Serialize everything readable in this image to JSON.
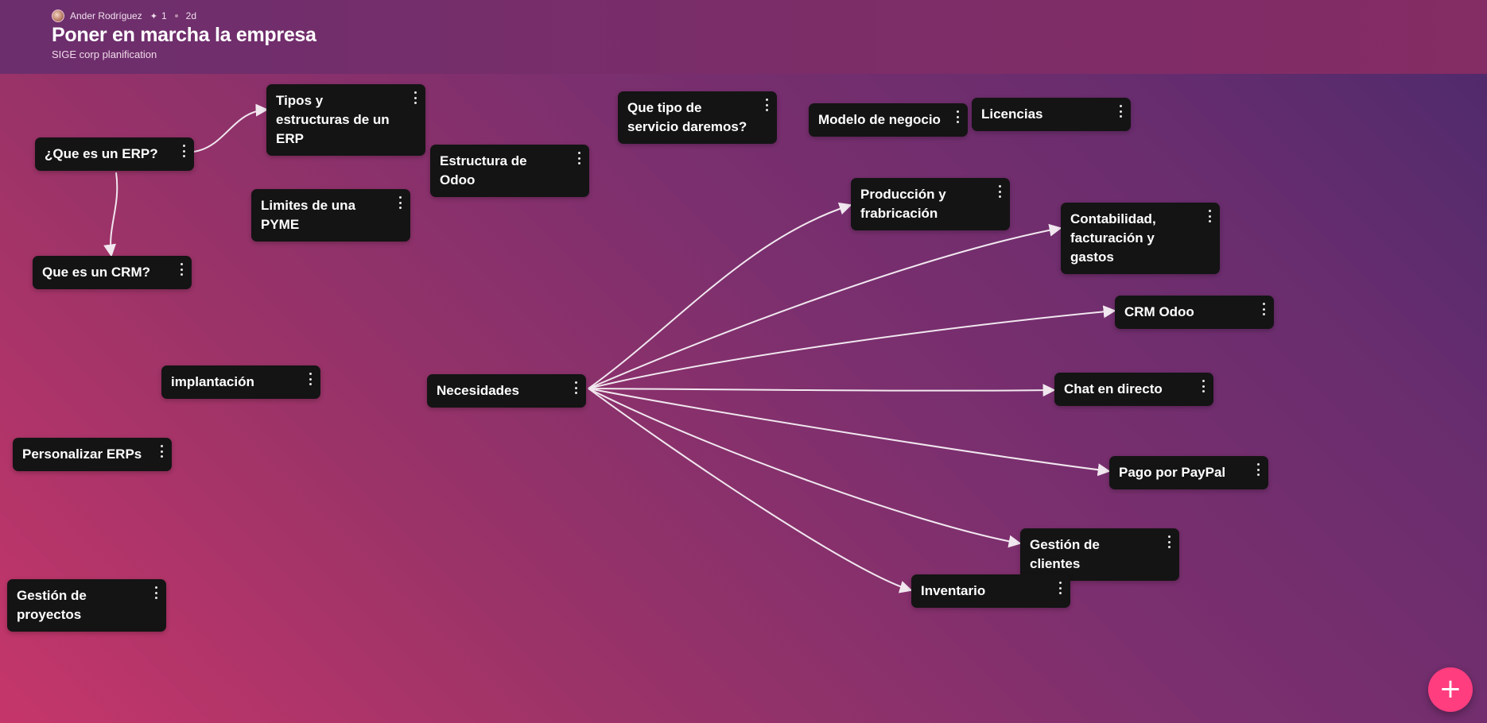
{
  "header": {
    "author": "Ander Rodríguez",
    "spark_icon": "sparkle-icon",
    "likes": "1",
    "age": "2d",
    "title": "Poner en marcha la empresa",
    "subtitle": "SIGE corp planification"
  },
  "cards": {
    "que_es_erp": "¿Que es un ERP?",
    "tipos_erp": "Tipos y estructuras de un ERP",
    "que_es_crm": "Que es un CRM?",
    "limites_pyme": "Limites de una PYME",
    "estructura_odoo": "Estructura de Odoo",
    "tipo_servicio": "Que tipo de servicio daremos?",
    "modelo_negocio": "Modelo de negocio",
    "licencias": "Licencias",
    "produccion": "Producción y frabricación",
    "contabilidad": "Contabilidad, facturación y gastos",
    "crm_odoo": "CRM Odoo",
    "chat_directo": "Chat en directo",
    "pago_paypal": "Pago por PayPal",
    "gestion_clientes": "Gestión de clientes",
    "inventario": "Inventario",
    "necesidades": "Necesidades",
    "implantacion": "implantación",
    "personalizar_erps": "Personalizar ERPs",
    "gestion_proyectos": "Gestión de proyectos"
  },
  "fab": {
    "icon": "plus-icon",
    "label": "+"
  },
  "colors": {
    "accent": "#ff3d7f",
    "card_bg": "#141414",
    "edge": "#f1e7ef"
  }
}
